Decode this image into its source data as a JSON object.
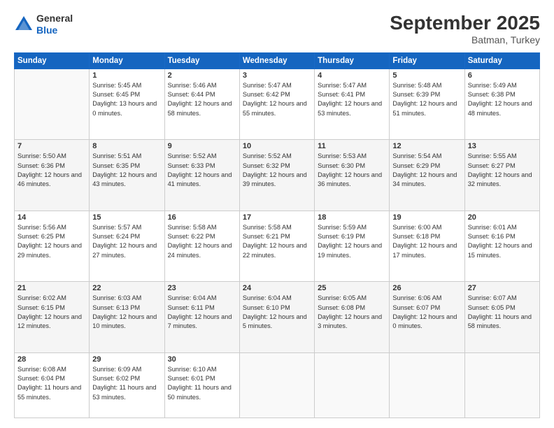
{
  "header": {
    "logo_general": "General",
    "logo_blue": "Blue",
    "month_title": "September 2025",
    "location": "Batman, Turkey"
  },
  "days_of_week": [
    "Sunday",
    "Monday",
    "Tuesday",
    "Wednesday",
    "Thursday",
    "Friday",
    "Saturday"
  ],
  "weeks": [
    [
      {
        "num": "",
        "sunrise": "",
        "sunset": "",
        "daylight": ""
      },
      {
        "num": "1",
        "sunrise": "Sunrise: 5:45 AM",
        "sunset": "Sunset: 6:45 PM",
        "daylight": "Daylight: 13 hours and 0 minutes."
      },
      {
        "num": "2",
        "sunrise": "Sunrise: 5:46 AM",
        "sunset": "Sunset: 6:44 PM",
        "daylight": "Daylight: 12 hours and 58 minutes."
      },
      {
        "num": "3",
        "sunrise": "Sunrise: 5:47 AM",
        "sunset": "Sunset: 6:42 PM",
        "daylight": "Daylight: 12 hours and 55 minutes."
      },
      {
        "num": "4",
        "sunrise": "Sunrise: 5:47 AM",
        "sunset": "Sunset: 6:41 PM",
        "daylight": "Daylight: 12 hours and 53 minutes."
      },
      {
        "num": "5",
        "sunrise": "Sunrise: 5:48 AM",
        "sunset": "Sunset: 6:39 PM",
        "daylight": "Daylight: 12 hours and 51 minutes."
      },
      {
        "num": "6",
        "sunrise": "Sunrise: 5:49 AM",
        "sunset": "Sunset: 6:38 PM",
        "daylight": "Daylight: 12 hours and 48 minutes."
      }
    ],
    [
      {
        "num": "7",
        "sunrise": "Sunrise: 5:50 AM",
        "sunset": "Sunset: 6:36 PM",
        "daylight": "Daylight: 12 hours and 46 minutes."
      },
      {
        "num": "8",
        "sunrise": "Sunrise: 5:51 AM",
        "sunset": "Sunset: 6:35 PM",
        "daylight": "Daylight: 12 hours and 43 minutes."
      },
      {
        "num": "9",
        "sunrise": "Sunrise: 5:52 AM",
        "sunset": "Sunset: 6:33 PM",
        "daylight": "Daylight: 12 hours and 41 minutes."
      },
      {
        "num": "10",
        "sunrise": "Sunrise: 5:52 AM",
        "sunset": "Sunset: 6:32 PM",
        "daylight": "Daylight: 12 hours and 39 minutes."
      },
      {
        "num": "11",
        "sunrise": "Sunrise: 5:53 AM",
        "sunset": "Sunset: 6:30 PM",
        "daylight": "Daylight: 12 hours and 36 minutes."
      },
      {
        "num": "12",
        "sunrise": "Sunrise: 5:54 AM",
        "sunset": "Sunset: 6:29 PM",
        "daylight": "Daylight: 12 hours and 34 minutes."
      },
      {
        "num": "13",
        "sunrise": "Sunrise: 5:55 AM",
        "sunset": "Sunset: 6:27 PM",
        "daylight": "Daylight: 12 hours and 32 minutes."
      }
    ],
    [
      {
        "num": "14",
        "sunrise": "Sunrise: 5:56 AM",
        "sunset": "Sunset: 6:25 PM",
        "daylight": "Daylight: 12 hours and 29 minutes."
      },
      {
        "num": "15",
        "sunrise": "Sunrise: 5:57 AM",
        "sunset": "Sunset: 6:24 PM",
        "daylight": "Daylight: 12 hours and 27 minutes."
      },
      {
        "num": "16",
        "sunrise": "Sunrise: 5:58 AM",
        "sunset": "Sunset: 6:22 PM",
        "daylight": "Daylight: 12 hours and 24 minutes."
      },
      {
        "num": "17",
        "sunrise": "Sunrise: 5:58 AM",
        "sunset": "Sunset: 6:21 PM",
        "daylight": "Daylight: 12 hours and 22 minutes."
      },
      {
        "num": "18",
        "sunrise": "Sunrise: 5:59 AM",
        "sunset": "Sunset: 6:19 PM",
        "daylight": "Daylight: 12 hours and 19 minutes."
      },
      {
        "num": "19",
        "sunrise": "Sunrise: 6:00 AM",
        "sunset": "Sunset: 6:18 PM",
        "daylight": "Daylight: 12 hours and 17 minutes."
      },
      {
        "num": "20",
        "sunrise": "Sunrise: 6:01 AM",
        "sunset": "Sunset: 6:16 PM",
        "daylight": "Daylight: 12 hours and 15 minutes."
      }
    ],
    [
      {
        "num": "21",
        "sunrise": "Sunrise: 6:02 AM",
        "sunset": "Sunset: 6:15 PM",
        "daylight": "Daylight: 12 hours and 12 minutes."
      },
      {
        "num": "22",
        "sunrise": "Sunrise: 6:03 AM",
        "sunset": "Sunset: 6:13 PM",
        "daylight": "Daylight: 12 hours and 10 minutes."
      },
      {
        "num": "23",
        "sunrise": "Sunrise: 6:04 AM",
        "sunset": "Sunset: 6:11 PM",
        "daylight": "Daylight: 12 hours and 7 minutes."
      },
      {
        "num": "24",
        "sunrise": "Sunrise: 6:04 AM",
        "sunset": "Sunset: 6:10 PM",
        "daylight": "Daylight: 12 hours and 5 minutes."
      },
      {
        "num": "25",
        "sunrise": "Sunrise: 6:05 AM",
        "sunset": "Sunset: 6:08 PM",
        "daylight": "Daylight: 12 hours and 3 minutes."
      },
      {
        "num": "26",
        "sunrise": "Sunrise: 6:06 AM",
        "sunset": "Sunset: 6:07 PM",
        "daylight": "Daylight: 12 hours and 0 minutes."
      },
      {
        "num": "27",
        "sunrise": "Sunrise: 6:07 AM",
        "sunset": "Sunset: 6:05 PM",
        "daylight": "Daylight: 11 hours and 58 minutes."
      }
    ],
    [
      {
        "num": "28",
        "sunrise": "Sunrise: 6:08 AM",
        "sunset": "Sunset: 6:04 PM",
        "daylight": "Daylight: 11 hours and 55 minutes."
      },
      {
        "num": "29",
        "sunrise": "Sunrise: 6:09 AM",
        "sunset": "Sunset: 6:02 PM",
        "daylight": "Daylight: 11 hours and 53 minutes."
      },
      {
        "num": "30",
        "sunrise": "Sunrise: 6:10 AM",
        "sunset": "Sunset: 6:01 PM",
        "daylight": "Daylight: 11 hours and 50 minutes."
      },
      {
        "num": "",
        "sunrise": "",
        "sunset": "",
        "daylight": ""
      },
      {
        "num": "",
        "sunrise": "",
        "sunset": "",
        "daylight": ""
      },
      {
        "num": "",
        "sunrise": "",
        "sunset": "",
        "daylight": ""
      },
      {
        "num": "",
        "sunrise": "",
        "sunset": "",
        "daylight": ""
      }
    ]
  ]
}
